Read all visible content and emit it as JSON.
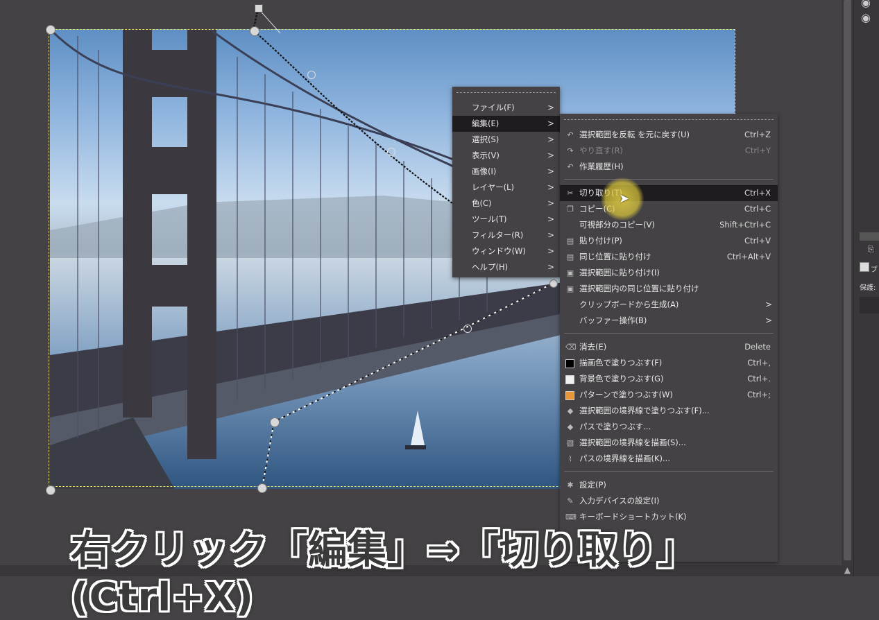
{
  "context_menu": {
    "items": [
      {
        "label": "ファイル(F)"
      },
      {
        "label": "編集(E)"
      },
      {
        "label": "選択(S)"
      },
      {
        "label": "表示(V)"
      },
      {
        "label": "画像(I)"
      },
      {
        "label": "レイヤー(L)"
      },
      {
        "label": "色(C)"
      },
      {
        "label": "ツール(T)"
      },
      {
        "label": "フィルター(R)"
      },
      {
        "label": "ウィンドウ(W)"
      },
      {
        "label": "ヘルプ(H)"
      }
    ]
  },
  "edit_menu": {
    "items": [
      {
        "label": "選択範囲を反転 を元に戻す(U)",
        "shortcut": "Ctrl+Z"
      },
      {
        "label": "やり直す(R)",
        "shortcut": "Ctrl+Y"
      },
      {
        "label": "作業履歴(H)",
        "shortcut": ""
      },
      {
        "label": "切り取り(T)",
        "shortcut": "Ctrl+X"
      },
      {
        "label": "コピー(C)",
        "shortcut": "Ctrl+C"
      },
      {
        "label": "可視部分のコピー(V)",
        "shortcut": "Shift+Ctrl+C"
      },
      {
        "label": "貼り付け(P)",
        "shortcut": "Ctrl+V"
      },
      {
        "label": "同じ位置に貼り付け",
        "shortcut": "Ctrl+Alt+V"
      },
      {
        "label": "選択範囲に貼り付け(I)",
        "shortcut": ""
      },
      {
        "label": "選択範囲内の同じ位置に貼り付け",
        "shortcut": ""
      },
      {
        "label": "クリップボードから生成(A)",
        "shortcut": ""
      },
      {
        "label": "バッファー操作(B)",
        "shortcut": ""
      },
      {
        "label": "消去(E)",
        "shortcut": "Delete"
      },
      {
        "label": "描画色で塗りつぶす(F)",
        "shortcut": "Ctrl+,"
      },
      {
        "label": "背景色で塗りつぶす(G)",
        "shortcut": "Ctrl+."
      },
      {
        "label": "パターンで塗りつぶす(W)",
        "shortcut": "Ctrl+;"
      },
      {
        "label": "選択範囲の境界線で塗りつぶす(F)...",
        "shortcut": ""
      },
      {
        "label": "パスで塗りつぶす...",
        "shortcut": ""
      },
      {
        "label": "選択範囲の境界線を描画(S)...",
        "shortcut": ""
      },
      {
        "label": "パスの境界線を描画(K)...",
        "shortcut": ""
      },
      {
        "label": "設定(P)",
        "shortcut": ""
      },
      {
        "label": "入力デバイスの設定(I)",
        "shortcut": ""
      },
      {
        "label": "キーボードショートカット(K)",
        "shortcut": ""
      }
    ]
  },
  "caption": "右クリック「編集」⇒「切り取り」(Ctrl+X)",
  "dock": {
    "label_fragment": "ブ",
    "protect_label": "保護:"
  },
  "colors": {
    "foreground_swatch": "#000000",
    "background_swatch": "#f0f0f0",
    "pattern_swatch": "#e9963a",
    "highlight": "#e6d246"
  }
}
